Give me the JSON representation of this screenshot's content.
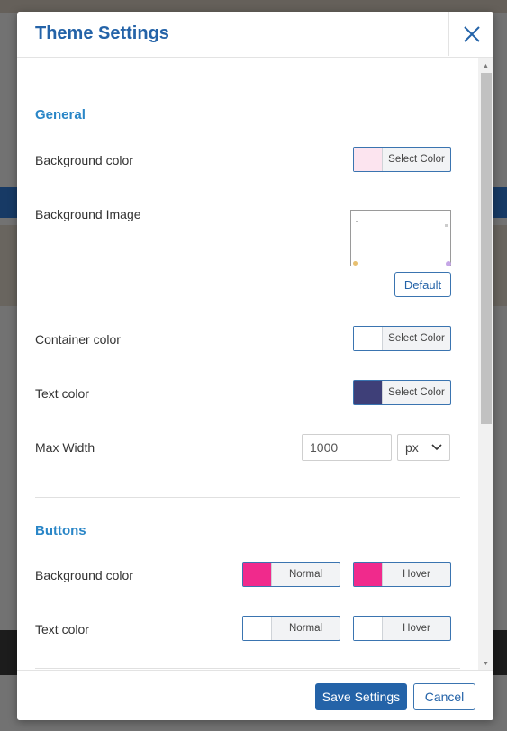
{
  "modal": {
    "title": "Theme Settings",
    "close_icon": "close-icon"
  },
  "colors": {
    "title": "#2463a8",
    "section": "#2a86c7",
    "button_primary": "#2463a8",
    "general_bg_swatch": "#fce4ef",
    "container_swatch": "#ffffff",
    "text_swatch": "#3e3f78",
    "buttons_bg_normal": "#f02a8c",
    "buttons_bg_hover": "#f02a8c",
    "buttons_text_normal": "#ffffff",
    "buttons_text_hover": "#ffffff"
  },
  "general": {
    "title": "General",
    "background_color": {
      "label": "Background color",
      "button": "Select Color"
    },
    "background_image": {
      "label": "Background Image",
      "default_button": "Default"
    },
    "container_color": {
      "label": "Container color",
      "button": "Select Color"
    },
    "text_color": {
      "label": "Text color",
      "button": "Select Color"
    },
    "max_width": {
      "label": "Max Width",
      "value": "1000",
      "unit": "px"
    }
  },
  "buttons": {
    "title": "Buttons",
    "background_color": {
      "label": "Background color",
      "normal": "Normal",
      "hover": "Hover"
    },
    "text_color": {
      "label": "Text color",
      "normal": "Normal",
      "hover": "Hover"
    }
  },
  "footer": {
    "save": "Save Settings",
    "cancel": "Cancel"
  }
}
